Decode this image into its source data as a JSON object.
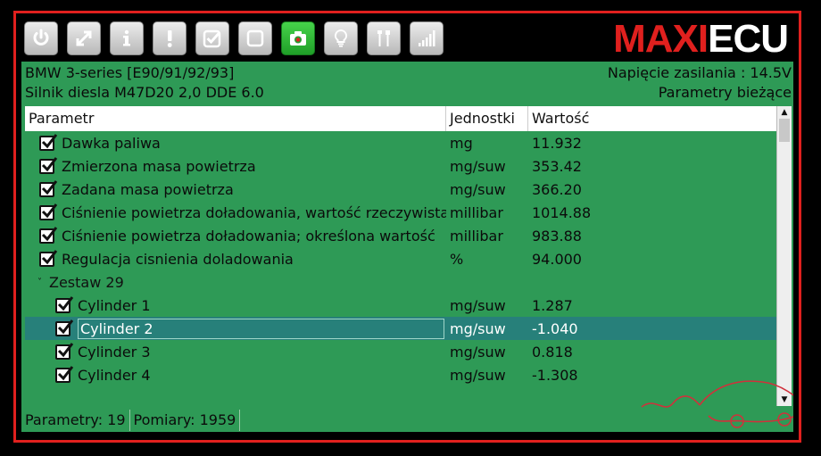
{
  "logo": {
    "part1": "MAXI",
    "part2": "ECU",
    "color_accent": "#e0201e"
  },
  "toolbar": {
    "buttons": [
      {
        "name": "power-icon"
      },
      {
        "name": "expand-icon"
      },
      {
        "name": "info-icon"
      },
      {
        "name": "alert-icon"
      },
      {
        "name": "checkbox-checked-icon"
      },
      {
        "name": "checkbox-empty-icon"
      },
      {
        "name": "camera-icon",
        "active": true
      },
      {
        "name": "lightbulb-icon"
      },
      {
        "name": "tools-icon"
      },
      {
        "name": "signal-bars-icon"
      }
    ]
  },
  "vehicle": {
    "model": "BMW 3-series [E90/91/92/93]",
    "engine": "Silnik diesla M47D20 2,0 DDE 6.0",
    "voltage": "Napięcie zasilania : 14.5V",
    "mode": "Parametry bieżące"
  },
  "table": {
    "headers": {
      "param": "Parametr",
      "unit": "Jednostki",
      "value": "Wartość"
    },
    "rows": [
      {
        "label": "Dawka paliwa",
        "unit": "mg",
        "value": "11.932"
      },
      {
        "label": "Zmierzona masa powietrza",
        "unit": "mg/suw",
        "value": "353.42"
      },
      {
        "label": "Zadana masa powietrza",
        "unit": "mg/suw",
        "value": "366.20"
      },
      {
        "label": "Ciśnienie powietrza doładowania, wartość rzeczywista",
        "unit": "millibar",
        "value": "1014.88"
      },
      {
        "label": "Ciśnienie powietrza doładowania; określona wartość",
        "unit": "millibar",
        "value": "983.88"
      },
      {
        "label": "Regulacja cisnienia doladowania",
        "unit": "%",
        "value": "94.000"
      }
    ],
    "group": {
      "label": "Zestaw 29"
    },
    "group_rows": [
      {
        "label": "Cylinder 1",
        "unit": "mg/suw",
        "value": "1.287"
      },
      {
        "label": "Cylinder 2",
        "unit": "mg/suw",
        "value": "-1.040"
      },
      {
        "label": "Cylinder 3",
        "unit": "mg/suw",
        "value": "0.818"
      },
      {
        "label": "Cylinder 4",
        "unit": "mg/suw",
        "value": "-1.308"
      }
    ]
  },
  "status": {
    "params": "Parametry: 19",
    "measurements": "Pomiary: 1959"
  },
  "colors": {
    "background": "#2e9a56",
    "selected_row": "#27807a",
    "frame": "#e0201e"
  }
}
